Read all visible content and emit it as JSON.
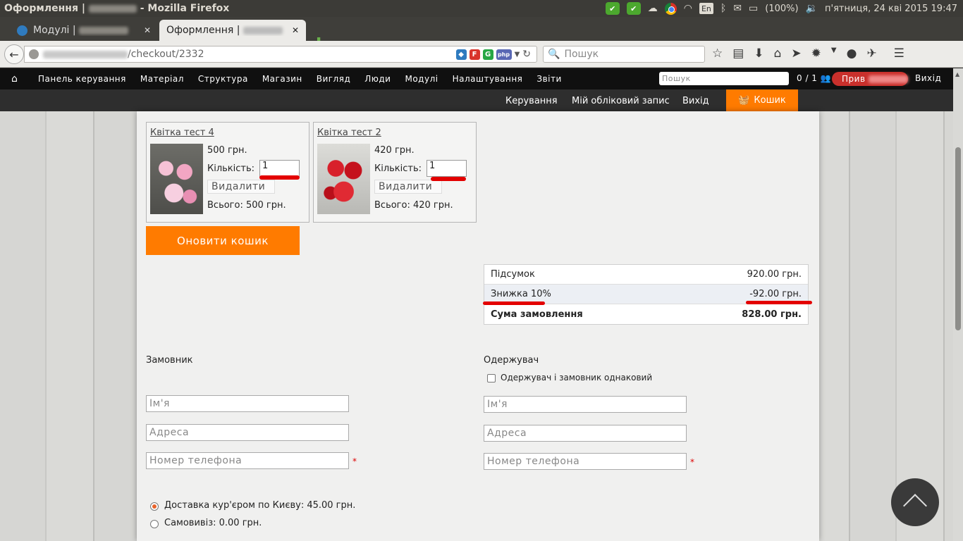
{
  "os": {
    "title_prefix": "Оформлення |",
    "title_suffix": "- Mozilla Firefox",
    "lang": "En",
    "battery": "(100%)",
    "datetime": "п'ятниця, 24 кві 2015 19:47"
  },
  "tabs": [
    {
      "label": "Модулі |",
      "active": false
    },
    {
      "label": "Оформлення |",
      "active": true
    }
  ],
  "nav": {
    "url": "/checkout/2332",
    "search_placeholder": "Пошук"
  },
  "admin": {
    "items": [
      "Панель керування",
      "Матеріал",
      "Структура",
      "Магазин",
      "Вигляд",
      "Люди",
      "Модулі",
      "Налаштування",
      "Звіти"
    ],
    "search_placeholder": "Пошук",
    "count": "0 / 1",
    "user_label": "Прив",
    "logout": "Вихід"
  },
  "site_menu": {
    "manage": "Керування",
    "account": "Мій обліковий запис",
    "logout": "Вихід",
    "cart": "Кошик"
  },
  "products": [
    {
      "title": "Квітка тест 4",
      "price": "500 грн.",
      "qty_label": "Кількість:",
      "qty": "1",
      "remove": "Видалити",
      "total": "Всього: 500 грн."
    },
    {
      "title": "Квітка тест 2",
      "price": "420 грн.",
      "qty_label": "Кількість:",
      "qty": "1",
      "remove": "Видалити",
      "total": "Всього: 420 грн."
    }
  ],
  "update_button": "Оновити кошик",
  "totals": {
    "subtotal_label": "Підсумок",
    "subtotal_value": "920.00 грн.",
    "discount_label": "Знижка 10%",
    "discount_value": "-92.00 грн.",
    "total_label": "Сума замовлення",
    "total_value": "828.00 грн."
  },
  "customer": {
    "title": "Замовник",
    "name_placeholder": "Ім'я",
    "address_placeholder": "Адреса",
    "phone_placeholder": "Номер телефона",
    "required_mark": "*"
  },
  "recipient": {
    "title": "Одержувач",
    "same_label": "Одержувач і замовник однаковий",
    "name_placeholder": "Ім'я",
    "address_placeholder": "Адреса",
    "phone_placeholder": "Номер телефона",
    "required_mark": "*"
  },
  "shipping": {
    "options": [
      {
        "label": "Доставка кур'єром по Києву: 45.00 грн.",
        "selected": true
      },
      {
        "label": "Самовивіз: 0.00 грн.",
        "selected": false
      }
    ]
  },
  "colors": {
    "accent": "#ff7b00",
    "admin_bg": "#101010",
    "annotation": "#e30000"
  },
  "icons": {
    "home": "home-icon",
    "cart": "basket-icon",
    "scroll_top": "chevron-up-icon"
  }
}
